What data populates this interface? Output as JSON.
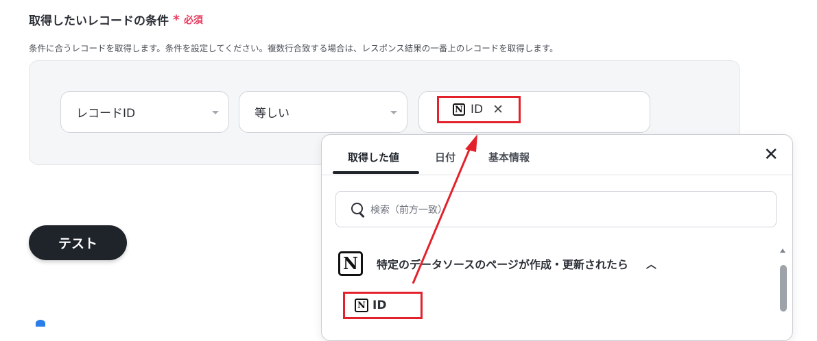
{
  "section": {
    "title": "取得したいレコードの条件",
    "required_mark": "*",
    "required_text": "必須",
    "description": "条件に合うレコードを取得します。条件を設定してください。複数行合致する場合は、レスポンス結果の一番上のレコードを取得します。"
  },
  "condition": {
    "field_value": "レコードID",
    "operator_value": "等しい",
    "chip_label": "ID",
    "chip_icon": "notion-icon",
    "chip_remove_icon": "close-icon"
  },
  "test_button": {
    "label": "テスト"
  },
  "popover": {
    "tabs": [
      {
        "label": "取得した値",
        "active": true
      },
      {
        "label": "日付",
        "active": false
      },
      {
        "label": "基本情報",
        "active": false
      }
    ],
    "close_icon": "close-icon",
    "search": {
      "placeholder": "検索（前方一致）",
      "icon": "search-icon"
    },
    "group": {
      "icon": "notion-icon",
      "label": "特定のデータソースのページが作成・更新されたら",
      "chevron_icon": "chevron-up-icon"
    },
    "items": [
      {
        "label": "ID",
        "icon": "notion-icon"
      }
    ]
  },
  "colors": {
    "highlight": "#e3212b",
    "required": "#e8365b",
    "button_bg": "#1f242b",
    "panel_bg": "#f5f6f8"
  }
}
